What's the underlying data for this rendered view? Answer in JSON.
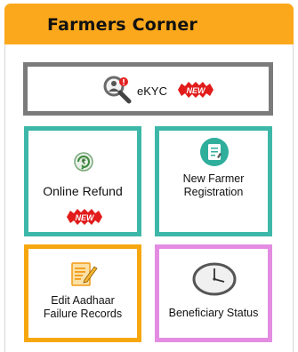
{
  "header": {
    "title": "Farmers Corner"
  },
  "tiles": {
    "ekyc": {
      "label": "eKYC",
      "badge": "NEW",
      "icon": "magnifier-user-icon"
    },
    "online_refund": {
      "label": "Online Refund",
      "badge": "NEW",
      "icon": "refund-icon"
    },
    "new_farmer": {
      "label_line1": "New Farmer",
      "label_line2": "Registration",
      "icon": "checklist-icon"
    },
    "edit_aadhaar": {
      "label_line1": "Edit Aadhaar",
      "label_line2": "Failure Records",
      "icon": "edit-document-icon"
    },
    "beneficiary": {
      "label": "Beneficiary Status",
      "icon": "clock-icon"
    }
  },
  "colors": {
    "header": "#fca81c",
    "ekyc_border": "#7b7b7b",
    "teal_border": "#3db8a8",
    "orange_border": "#f6a710",
    "pink_border": "#e38ce2",
    "badge": "#e21b1b"
  }
}
